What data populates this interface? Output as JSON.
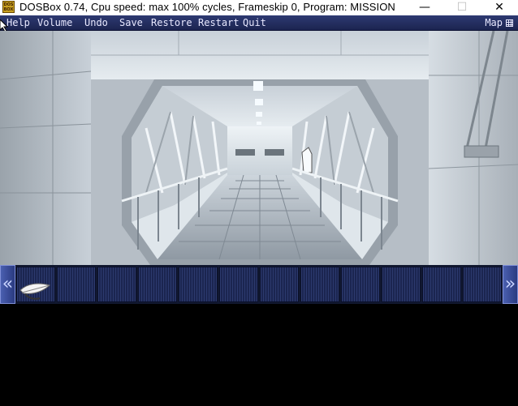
{
  "window": {
    "title": "DOSBox 0.74, Cpu speed: max 100% cycles, Frameskip  0, Program:  MISSION",
    "icon_label": "DOS BOX",
    "controls": {
      "minimize": "—",
      "maximize": "☐",
      "close": "✕"
    }
  },
  "menu": {
    "items": [
      "Help",
      "Volume",
      "Undo",
      "Save",
      "Restore",
      "Restart",
      "Quit"
    ],
    "map_label": "Map"
  },
  "inventory": {
    "left_arrow": "«",
    "right_arrow": "»",
    "slot_count": 12,
    "items": [
      "feather"
    ]
  }
}
